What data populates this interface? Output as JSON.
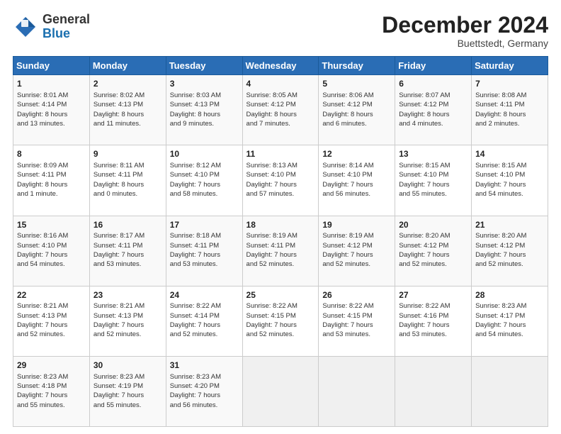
{
  "header": {
    "logo_line1": "General",
    "logo_line2": "Blue",
    "title": "December 2024",
    "subtitle": "Buettstedt, Germany"
  },
  "days_of_week": [
    "Sunday",
    "Monday",
    "Tuesday",
    "Wednesday",
    "Thursday",
    "Friday",
    "Saturday"
  ],
  "weeks": [
    [
      {
        "day": "1",
        "lines": [
          "Sunrise: 8:01 AM",
          "Sunset: 4:14 PM",
          "Daylight: 8 hours",
          "and 13 minutes."
        ]
      },
      {
        "day": "2",
        "lines": [
          "Sunrise: 8:02 AM",
          "Sunset: 4:13 PM",
          "Daylight: 8 hours",
          "and 11 minutes."
        ]
      },
      {
        "day": "3",
        "lines": [
          "Sunrise: 8:03 AM",
          "Sunset: 4:13 PM",
          "Daylight: 8 hours",
          "and 9 minutes."
        ]
      },
      {
        "day": "4",
        "lines": [
          "Sunrise: 8:05 AM",
          "Sunset: 4:12 PM",
          "Daylight: 8 hours",
          "and 7 minutes."
        ]
      },
      {
        "day": "5",
        "lines": [
          "Sunrise: 8:06 AM",
          "Sunset: 4:12 PM",
          "Daylight: 8 hours",
          "and 6 minutes."
        ]
      },
      {
        "day": "6",
        "lines": [
          "Sunrise: 8:07 AM",
          "Sunset: 4:12 PM",
          "Daylight: 8 hours",
          "and 4 minutes."
        ]
      },
      {
        "day": "7",
        "lines": [
          "Sunrise: 8:08 AM",
          "Sunset: 4:11 PM",
          "Daylight: 8 hours",
          "and 2 minutes."
        ]
      }
    ],
    [
      {
        "day": "8",
        "lines": [
          "Sunrise: 8:09 AM",
          "Sunset: 4:11 PM",
          "Daylight: 8 hours",
          "and 1 minute."
        ]
      },
      {
        "day": "9",
        "lines": [
          "Sunrise: 8:11 AM",
          "Sunset: 4:11 PM",
          "Daylight: 8 hours",
          "and 0 minutes."
        ]
      },
      {
        "day": "10",
        "lines": [
          "Sunrise: 8:12 AM",
          "Sunset: 4:10 PM",
          "Daylight: 7 hours",
          "and 58 minutes."
        ]
      },
      {
        "day": "11",
        "lines": [
          "Sunrise: 8:13 AM",
          "Sunset: 4:10 PM",
          "Daylight: 7 hours",
          "and 57 minutes."
        ]
      },
      {
        "day": "12",
        "lines": [
          "Sunrise: 8:14 AM",
          "Sunset: 4:10 PM",
          "Daylight: 7 hours",
          "and 56 minutes."
        ]
      },
      {
        "day": "13",
        "lines": [
          "Sunrise: 8:15 AM",
          "Sunset: 4:10 PM",
          "Daylight: 7 hours",
          "and 55 minutes."
        ]
      },
      {
        "day": "14",
        "lines": [
          "Sunrise: 8:15 AM",
          "Sunset: 4:10 PM",
          "Daylight: 7 hours",
          "and 54 minutes."
        ]
      }
    ],
    [
      {
        "day": "15",
        "lines": [
          "Sunrise: 8:16 AM",
          "Sunset: 4:10 PM",
          "Daylight: 7 hours",
          "and 54 minutes."
        ]
      },
      {
        "day": "16",
        "lines": [
          "Sunrise: 8:17 AM",
          "Sunset: 4:11 PM",
          "Daylight: 7 hours",
          "and 53 minutes."
        ]
      },
      {
        "day": "17",
        "lines": [
          "Sunrise: 8:18 AM",
          "Sunset: 4:11 PM",
          "Daylight: 7 hours",
          "and 53 minutes."
        ]
      },
      {
        "day": "18",
        "lines": [
          "Sunrise: 8:19 AM",
          "Sunset: 4:11 PM",
          "Daylight: 7 hours",
          "and 52 minutes."
        ]
      },
      {
        "day": "19",
        "lines": [
          "Sunrise: 8:19 AM",
          "Sunset: 4:12 PM",
          "Daylight: 7 hours",
          "and 52 minutes."
        ]
      },
      {
        "day": "20",
        "lines": [
          "Sunrise: 8:20 AM",
          "Sunset: 4:12 PM",
          "Daylight: 7 hours",
          "and 52 minutes."
        ]
      },
      {
        "day": "21",
        "lines": [
          "Sunrise: 8:20 AM",
          "Sunset: 4:12 PM",
          "Daylight: 7 hours",
          "and 52 minutes."
        ]
      }
    ],
    [
      {
        "day": "22",
        "lines": [
          "Sunrise: 8:21 AM",
          "Sunset: 4:13 PM",
          "Daylight: 7 hours",
          "and 52 minutes."
        ]
      },
      {
        "day": "23",
        "lines": [
          "Sunrise: 8:21 AM",
          "Sunset: 4:13 PM",
          "Daylight: 7 hours",
          "and 52 minutes."
        ]
      },
      {
        "day": "24",
        "lines": [
          "Sunrise: 8:22 AM",
          "Sunset: 4:14 PM",
          "Daylight: 7 hours",
          "and 52 minutes."
        ]
      },
      {
        "day": "25",
        "lines": [
          "Sunrise: 8:22 AM",
          "Sunset: 4:15 PM",
          "Daylight: 7 hours",
          "and 52 minutes."
        ]
      },
      {
        "day": "26",
        "lines": [
          "Sunrise: 8:22 AM",
          "Sunset: 4:15 PM",
          "Daylight: 7 hours",
          "and 53 minutes."
        ]
      },
      {
        "day": "27",
        "lines": [
          "Sunrise: 8:22 AM",
          "Sunset: 4:16 PM",
          "Daylight: 7 hours",
          "and 53 minutes."
        ]
      },
      {
        "day": "28",
        "lines": [
          "Sunrise: 8:23 AM",
          "Sunset: 4:17 PM",
          "Daylight: 7 hours",
          "and 54 minutes."
        ]
      }
    ],
    [
      {
        "day": "29",
        "lines": [
          "Sunrise: 8:23 AM",
          "Sunset: 4:18 PM",
          "Daylight: 7 hours",
          "and 55 minutes."
        ]
      },
      {
        "day": "30",
        "lines": [
          "Sunrise: 8:23 AM",
          "Sunset: 4:19 PM",
          "Daylight: 7 hours",
          "and 55 minutes."
        ]
      },
      {
        "day": "31",
        "lines": [
          "Sunrise: 8:23 AM",
          "Sunset: 4:20 PM",
          "Daylight: 7 hours",
          "and 56 minutes."
        ]
      },
      null,
      null,
      null,
      null
    ]
  ]
}
